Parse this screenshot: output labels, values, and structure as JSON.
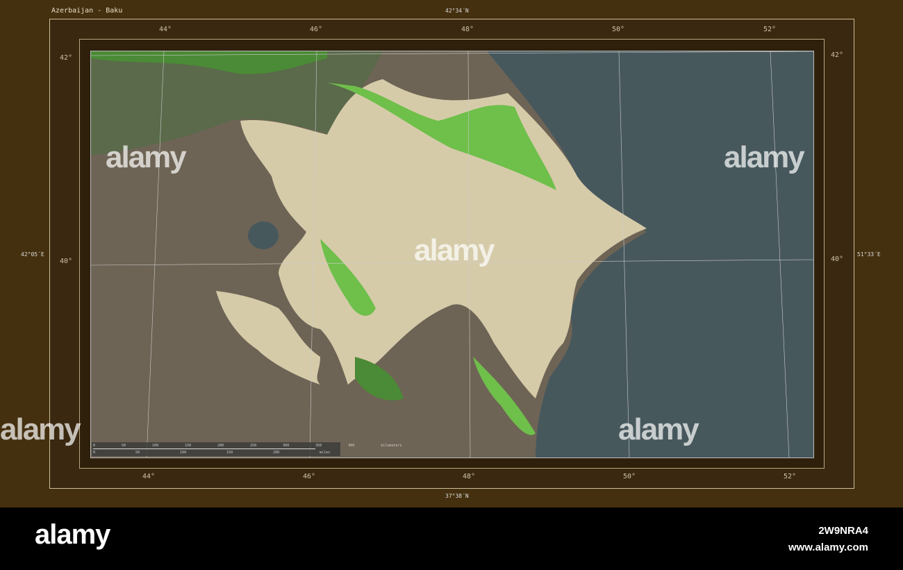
{
  "title": "Azerbaijan - Baku",
  "edges": {
    "top": "42°34´N",
    "bottom": "37°38´N",
    "left": "42°05´E",
    "right": "51°33´E"
  },
  "lon_top": [
    "44°",
    "46°",
    "48°",
    "50°",
    "52°"
  ],
  "lon_bottom": [
    "44°",
    "46°",
    "48°",
    "50°",
    "52°"
  ],
  "lat_left": [
    "42°",
    "40°"
  ],
  "lat_right": [
    "42°",
    "40°"
  ],
  "scale": {
    "km_ticks": [
      "0",
      "50",
      "100",
      "150",
      "200",
      "250",
      "300",
      "350",
      "400"
    ],
    "km_unit": "kilometers",
    "mi_ticks": [
      "0",
      "50",
      "100",
      "150",
      "200"
    ],
    "mi_unit": "miles"
  },
  "watermark": "alamy",
  "footer": {
    "logo": "alamy",
    "image_id": "2W9NRA4",
    "url": "www.alamy.com"
  },
  "colors": {
    "sea": "#47585d",
    "land": "#6e6455",
    "country": "#d6cba9",
    "mountains": "#6fbf4b",
    "frame": "#44300f"
  }
}
